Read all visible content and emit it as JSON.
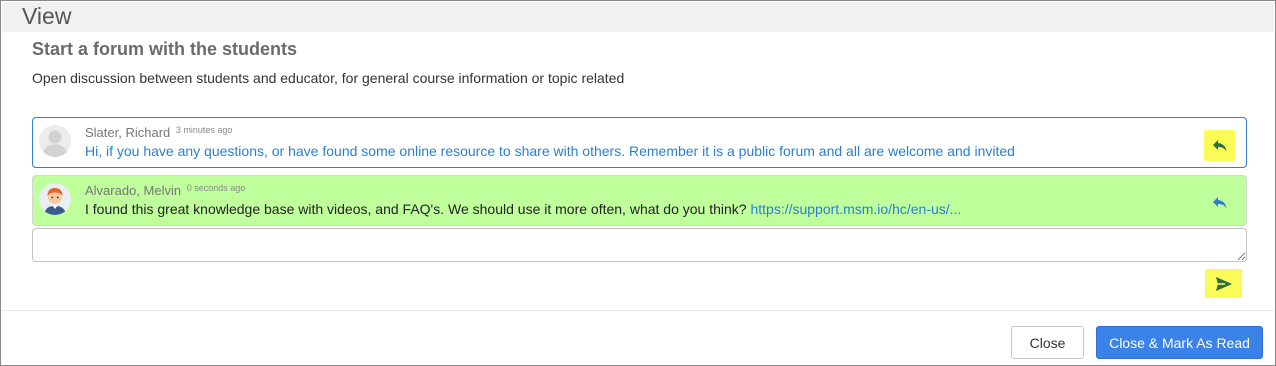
{
  "header": {
    "title": "View"
  },
  "forum": {
    "title": "Start a forum with the students",
    "description": "Open discussion between students and educator, for general course information or topic related"
  },
  "messages": [
    {
      "author": "Slater, Richard",
      "time_ago": "3 minutes ago",
      "text": "Hi, if you have any questions, or have found some online resource to share with others. Remember it is a public forum and all are welcome and invited",
      "link": "",
      "avatar_icon": "default-user-avatar-icon",
      "reply_icon": "reply-arrow-icon"
    },
    {
      "author": "Alvarado, Melvin",
      "time_ago": "0 seconds ago",
      "text": "I found this great knowledge base with videos, and FAQ's. We should use it more often, what do you think?",
      "link": "https://support.msm.io/hc/en-us/...",
      "avatar_icon": "cartoon-person-avatar-icon",
      "reply_icon": "reply-arrow-icon"
    }
  ],
  "reply_input": {
    "value": "",
    "placeholder": ""
  },
  "send_icon": "send-paper-plane-icon",
  "footer": {
    "close_label": "Close",
    "close_mark_read_label": "Close & Mark As Read"
  },
  "colors": {
    "accent_blue": "#3b82e8",
    "link_blue": "#2b7fd1",
    "highlight_yellow": "#fbfb58",
    "new_message_green": "#bfff9c"
  }
}
